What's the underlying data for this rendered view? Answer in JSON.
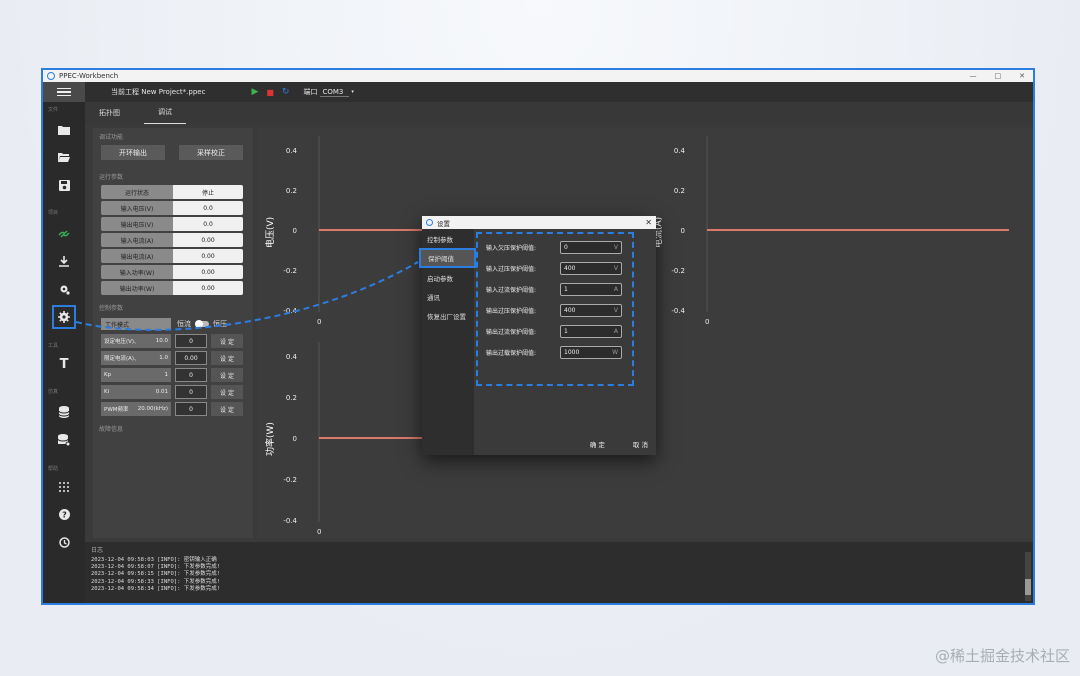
{
  "window": {
    "title": "PPEC-Workbench",
    "controls": [
      "—",
      "□",
      "✕"
    ]
  },
  "topbar": {
    "project_label": "当前工程 New Project*.ppec",
    "port_label": "端口",
    "port_value": "COM3"
  },
  "tabs": [
    {
      "label": "拓扑图"
    },
    {
      "label": "调试"
    }
  ],
  "sidebar": {
    "sections": [
      "文件",
      "项目",
      "工具",
      "仿真",
      "帮助"
    ],
    "icons": [
      "folder-add-icon",
      "folder-open-icon",
      "save-icon",
      "link-icon",
      "download-icon",
      "chip-settings-icon",
      "gear-icon",
      "text-tool-icon",
      "database-icon",
      "database-settings-icon",
      "grid-icon",
      "help-icon",
      "history-icon"
    ]
  },
  "debug": {
    "title": "调试功能",
    "open_loop_button": "开环输出",
    "calibrate_button": "采样校正"
  },
  "run_params": {
    "title": "运行参数",
    "rows": [
      {
        "label": "运行状态",
        "value": "停止"
      },
      {
        "label": "输入电压(V)",
        "value": "0.0"
      },
      {
        "label": "输出电压(V)",
        "value": "0.0"
      },
      {
        "label": "输入电流(A)",
        "value": "0.00"
      },
      {
        "label": "输出电流(A)",
        "value": "0.00"
      },
      {
        "label": "输入功率(W)",
        "value": "0.00"
      },
      {
        "label": "输出功率(W)",
        "value": "0.00"
      }
    ]
  },
  "control_params": {
    "title": "控制参数",
    "mode_label": "工作模式",
    "mode_left": "恒流",
    "mode_right": "恒压",
    "rows": [
      {
        "label": "设定电压(V)、",
        "hint": "10.0",
        "value": "0",
        "button": "设 定"
      },
      {
        "label": "限定电流(A)、",
        "hint": "1.0",
        "value": "0.00",
        "button": "设 定"
      },
      {
        "label": "Kp",
        "hint": "1",
        "value": "0",
        "button": "设 定"
      },
      {
        "label": "Ki",
        "hint": "0.01",
        "value": "0",
        "button": "设 定"
      },
      {
        "label": "PWM频率",
        "hint": "20.00(kHz)",
        "value": "0",
        "button": "设 定"
      }
    ]
  },
  "fault": {
    "title": "故障信息"
  },
  "charts": {
    "voltage": {
      "ylabel": "电压(V)",
      "ticks": [
        "0.4",
        "0.2",
        "0",
        "-0.2",
        "-0.4"
      ],
      "x0": "0"
    },
    "current": {
      "ylabel": "电流(A)",
      "ticks": [
        "0.4",
        "0.2",
        "0",
        "-0.2",
        "-0.4"
      ],
      "x0": "0"
    },
    "power": {
      "ylabel": "功率(W)",
      "ticks": [
        "0.4",
        "0.2",
        "0",
        "-0.2",
        "-0.4"
      ],
      "x0": "0"
    },
    "line_color": "#f08070"
  },
  "dialog": {
    "title": "设置",
    "nav": [
      "控制参数",
      "保护阈值",
      "启动参数",
      "通讯",
      "恢复出厂设置"
    ],
    "fields": [
      {
        "label": "输入欠压保护阈值:",
        "value": "0",
        "unit": "V"
      },
      {
        "label": "输入过压保护阈值:",
        "value": "400",
        "unit": "V"
      },
      {
        "label": "输入过流保护阈值:",
        "value": "1",
        "unit": "A"
      },
      {
        "label": "输出过压保护阈值:",
        "value": "400",
        "unit": "V"
      },
      {
        "label": "输出过流保护阈值:",
        "value": "1",
        "unit": "A"
      },
      {
        "label": "输出过载保护阈值:",
        "value": "1000",
        "unit": "W"
      }
    ],
    "ok": "确 定",
    "cancel": "取 消"
  },
  "log": {
    "title": "日志",
    "lines": [
      "2023-12-04 09:58:03 [INFO]: 密钥输入正确",
      "2023-12-04 09:58:07 [INFO]: 下发参数完成!",
      "2023-12-04 09:58:15 [INFO]: 下发参数完成!",
      "2023-12-04 09:58:33 [INFO]: 下发参数完成!",
      "2023-12-04 09:58:34 [INFO]: 下发参数完成!"
    ]
  },
  "watermark": "@稀土掘金技术社区",
  "colors": {
    "accent": "#2b7de0",
    "play": "#3cb54a",
    "stop": "#dd3333"
  }
}
